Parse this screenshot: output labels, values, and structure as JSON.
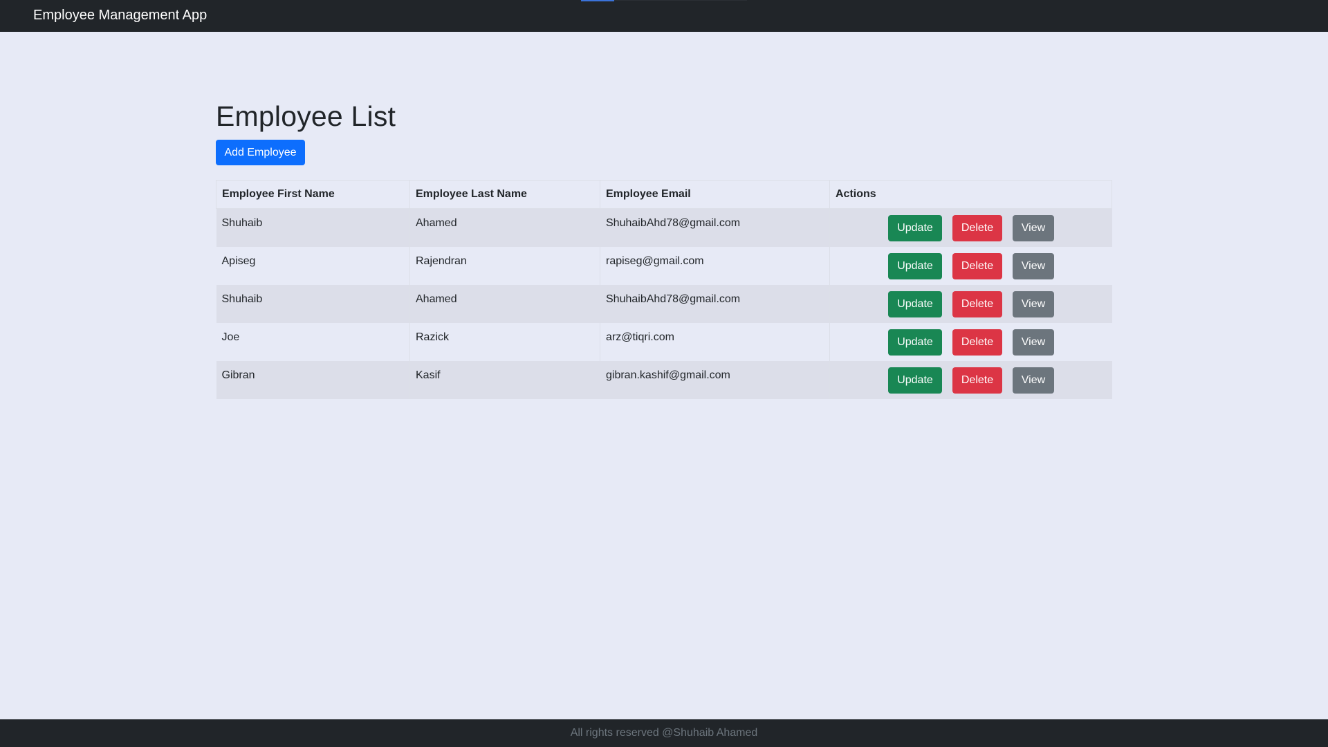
{
  "navbar": {
    "brand": "Employee Management App"
  },
  "page": {
    "title": "Employee List",
    "add_button_label": "Add Employee"
  },
  "table": {
    "headers": [
      "Employee First Name",
      "Employee Last Name",
      "Employee Email",
      "Actions"
    ],
    "rows": [
      {
        "first_name": "Shuhaib",
        "last_name": "Ahamed",
        "email": "ShuhaibAhd78@gmail.com"
      },
      {
        "first_name": "Apiseg",
        "last_name": "Rajendran",
        "email": "rapiseg@gmail.com"
      },
      {
        "first_name": "Shuhaib",
        "last_name": "Ahamed",
        "email": "ShuhaibAhd78@gmail.com"
      },
      {
        "first_name": "Joe",
        "last_name": "Razick",
        "email": "arz@tiqri.com"
      },
      {
        "first_name": "Gibran",
        "last_name": "Kasif",
        "email": "gibran.kashif@gmail.com"
      }
    ],
    "actions": {
      "update": "Update",
      "delete": "Delete",
      "view": "View"
    }
  },
  "footer": {
    "text": "All rights reserved @Shuhaib Ahamed"
  },
  "colors": {
    "navbar_bg": "#212529",
    "page_bg": "#e7eaf6",
    "primary": "#0d6efd",
    "success": "#198754",
    "danger": "#dc3545",
    "secondary": "#6c757d"
  }
}
